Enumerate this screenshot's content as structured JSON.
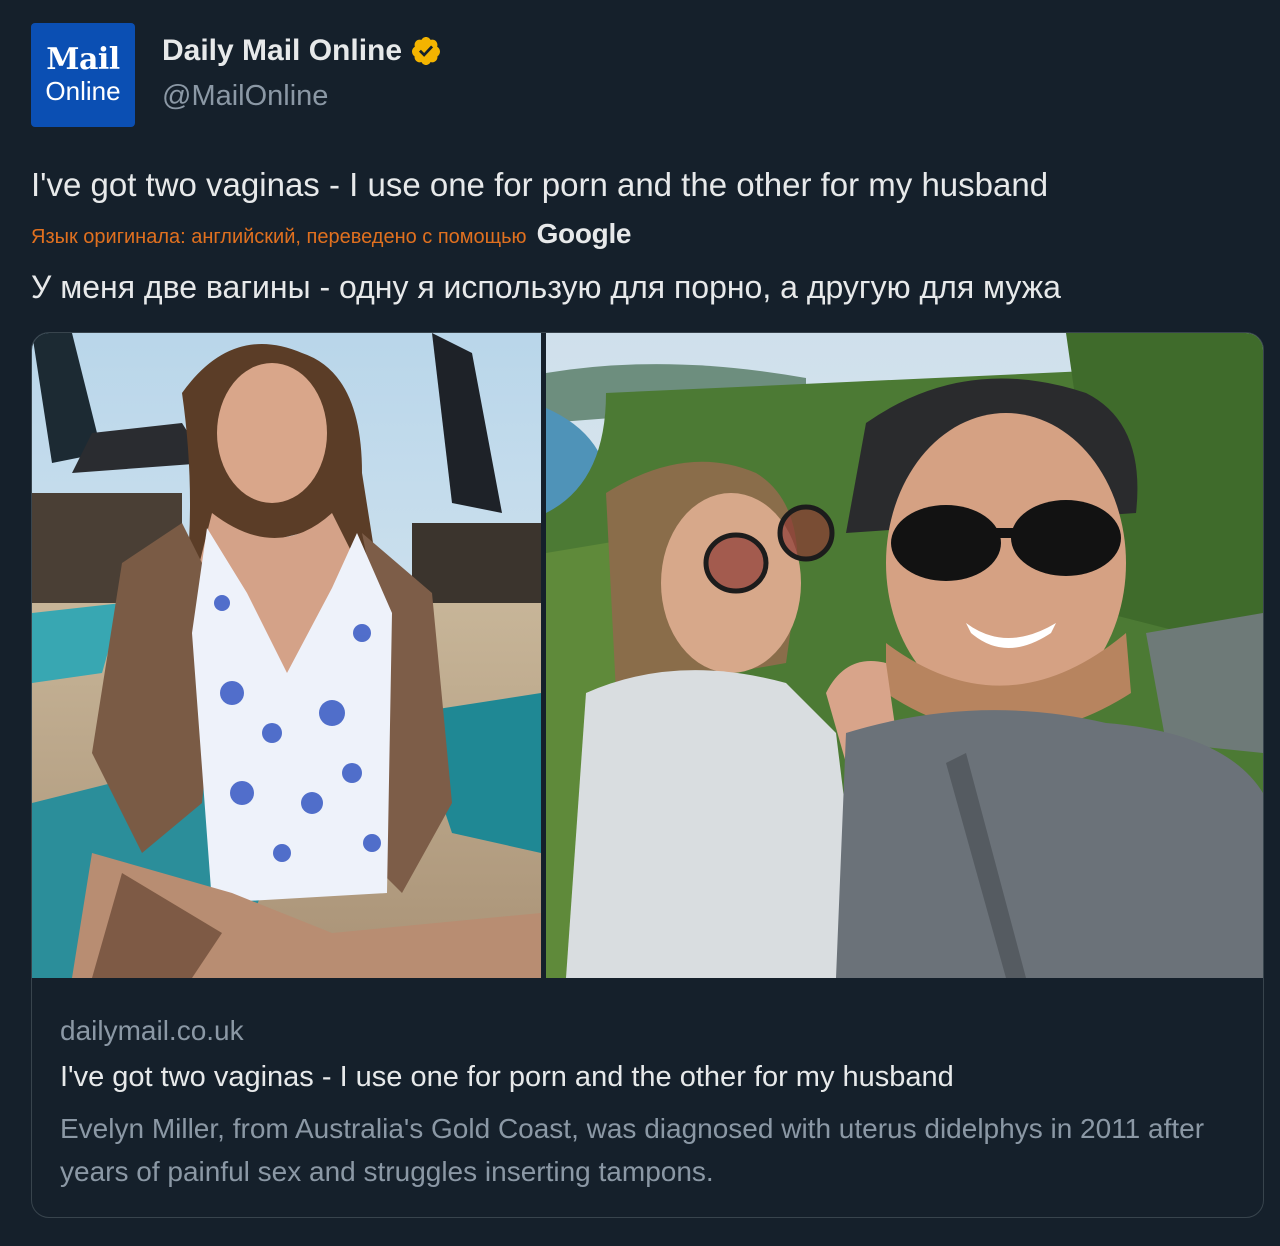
{
  "account": {
    "avatar_line1": "Mail",
    "avatar_line2": "Online",
    "display_name": "Daily Mail Online",
    "handle": "@MailOnline",
    "verified_color": "#f4b400"
  },
  "tweet": {
    "text": "I've got two vaginas - I use one for porn and the other for my husband",
    "translation_note": "Язык оригинала: английский, переведено с помощью",
    "translation_provider": "Google",
    "translated_text": "У меня две вагины - одну я использую для порно, а другую для мужа"
  },
  "card": {
    "domain": "dailymail.co.uk",
    "title": "I've got two vaginas - I use one for porn and the other for my husband",
    "description": "Evelyn Miller, from Australia's Gold Coast, was diagnosed with uterus didelphys in 2011 after years of painful sex and struggles inserting tampons."
  },
  "theme": {
    "background": "#15202b",
    "text_primary": "#e7e9ea",
    "text_secondary": "#8b98a5",
    "translation_note_color": "#e0701f",
    "avatar_bg": "#0b4fb3"
  }
}
